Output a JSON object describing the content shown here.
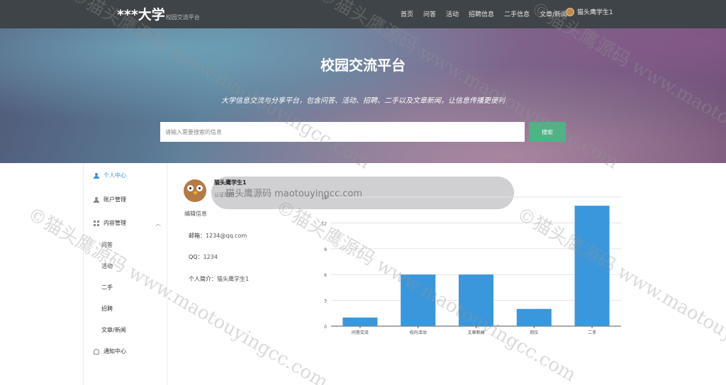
{
  "navbar": {
    "brand": "***大学",
    "brand_sub": "校园交流平台",
    "links": [
      "首页",
      "问答",
      "活动",
      "招聘信息",
      "二手信息",
      "文章/新闻"
    ],
    "user": "猫头鹰学生1"
  },
  "hero": {
    "title": "校园交流平台",
    "subtitle": "大学信息交流与分享平台，包含问答、活动、招聘、二手以及文章新闻，让信息传播更便利",
    "search_placeholder": "请输入需要搜索的信息",
    "search_button": "搜索"
  },
  "sidebar": {
    "personal_center": "个人中心",
    "account_manage": "账户管理",
    "content_manage": "内容管理",
    "sub_items": [
      "问答",
      "活动",
      "二手",
      "招聘",
      "文章/新闻"
    ],
    "notifications": "通知中心"
  },
  "profile": {
    "username": "猫头鹰学生1",
    "role": "认证用户",
    "edit": "编辑信息",
    "email_label": "邮箱：",
    "email": "1234@qq.com",
    "qq_label": "QQ：",
    "qq": "1234",
    "bio_label": "个人简介：",
    "bio": "猫头鹰学生1"
  },
  "watermark": {
    "pill_text": "猫头鹰源码 maotouyingcc.com",
    "text": "©猫头鹰源码 www.maotouyingcc.com"
  },
  "colors": {
    "navbar": "#3e4448",
    "search_button": "#4bb584",
    "bar": "#3a97db",
    "active": "#3a8ee6"
  },
  "chart_data": {
    "type": "bar",
    "categories": [
      "问答交流",
      "校内活动",
      "文章新闻",
      "岗位",
      "二手"
    ],
    "values": [
      1,
      6,
      6,
      2,
      14
    ],
    "ylim": [
      0,
      15
    ],
    "yticks": [
      0,
      3,
      6,
      9,
      12,
      15
    ],
    "grid": true
  }
}
